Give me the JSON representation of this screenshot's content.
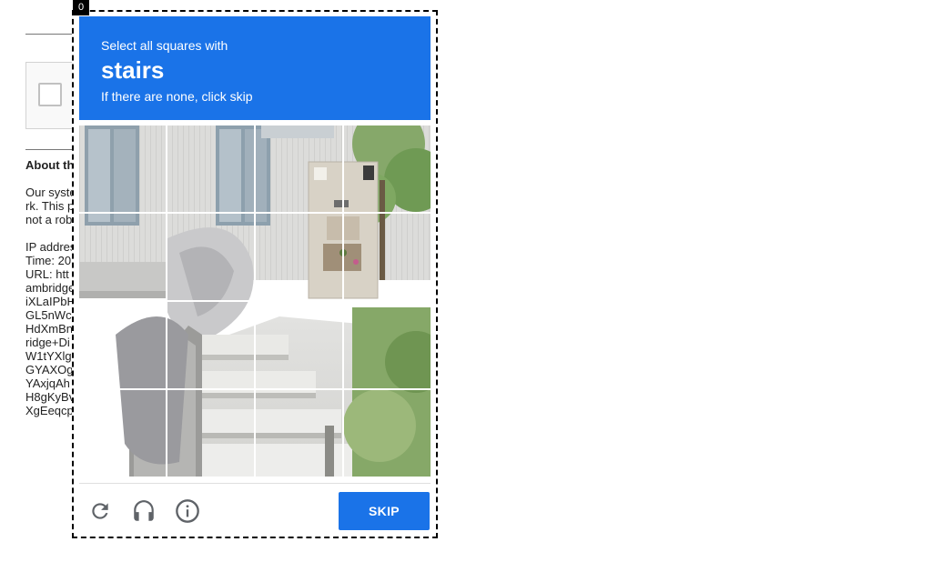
{
  "frame_badge": "0",
  "background_page": {
    "about_heading": "About th",
    "paragraph_lines": [
      "Our syste",
      "rk. This p",
      "not a robo"
    ],
    "info_lines": [
      "IP addres",
      "Time: 20",
      "URL: htt",
      "ambridge",
      "iXLaIPbH",
      "GL5nWc",
      "HdXmBn",
      "ridge+Di",
      "W1tYXlg",
      "GYAXOg",
      "YAxjqAh",
      "H8gKyBv",
      "XgEeqcp"
    ]
  },
  "challenge": {
    "instruction_line1": "Select all squares with",
    "object_name": "stairs",
    "instruction_line3": "If there are none, click skip",
    "grid_rows": 4,
    "grid_cols": 4,
    "skip_label": "SKIP",
    "icons": [
      "reload-icon",
      "audio-headphones-icon",
      "info-icon"
    ]
  },
  "colors": {
    "accent": "#1a73e8",
    "text_on_accent": "#ffffff"
  }
}
